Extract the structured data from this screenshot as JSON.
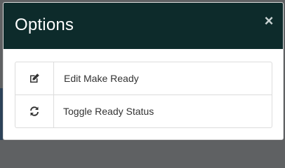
{
  "modal": {
    "title": "Options",
    "close_glyph": "×",
    "header_color": "#0d2b2b",
    "options": [
      {
        "label": "Edit Make Ready",
        "icon": "edit-icon"
      },
      {
        "label": "Toggle Ready Status",
        "icon": "refresh-icon"
      }
    ]
  }
}
